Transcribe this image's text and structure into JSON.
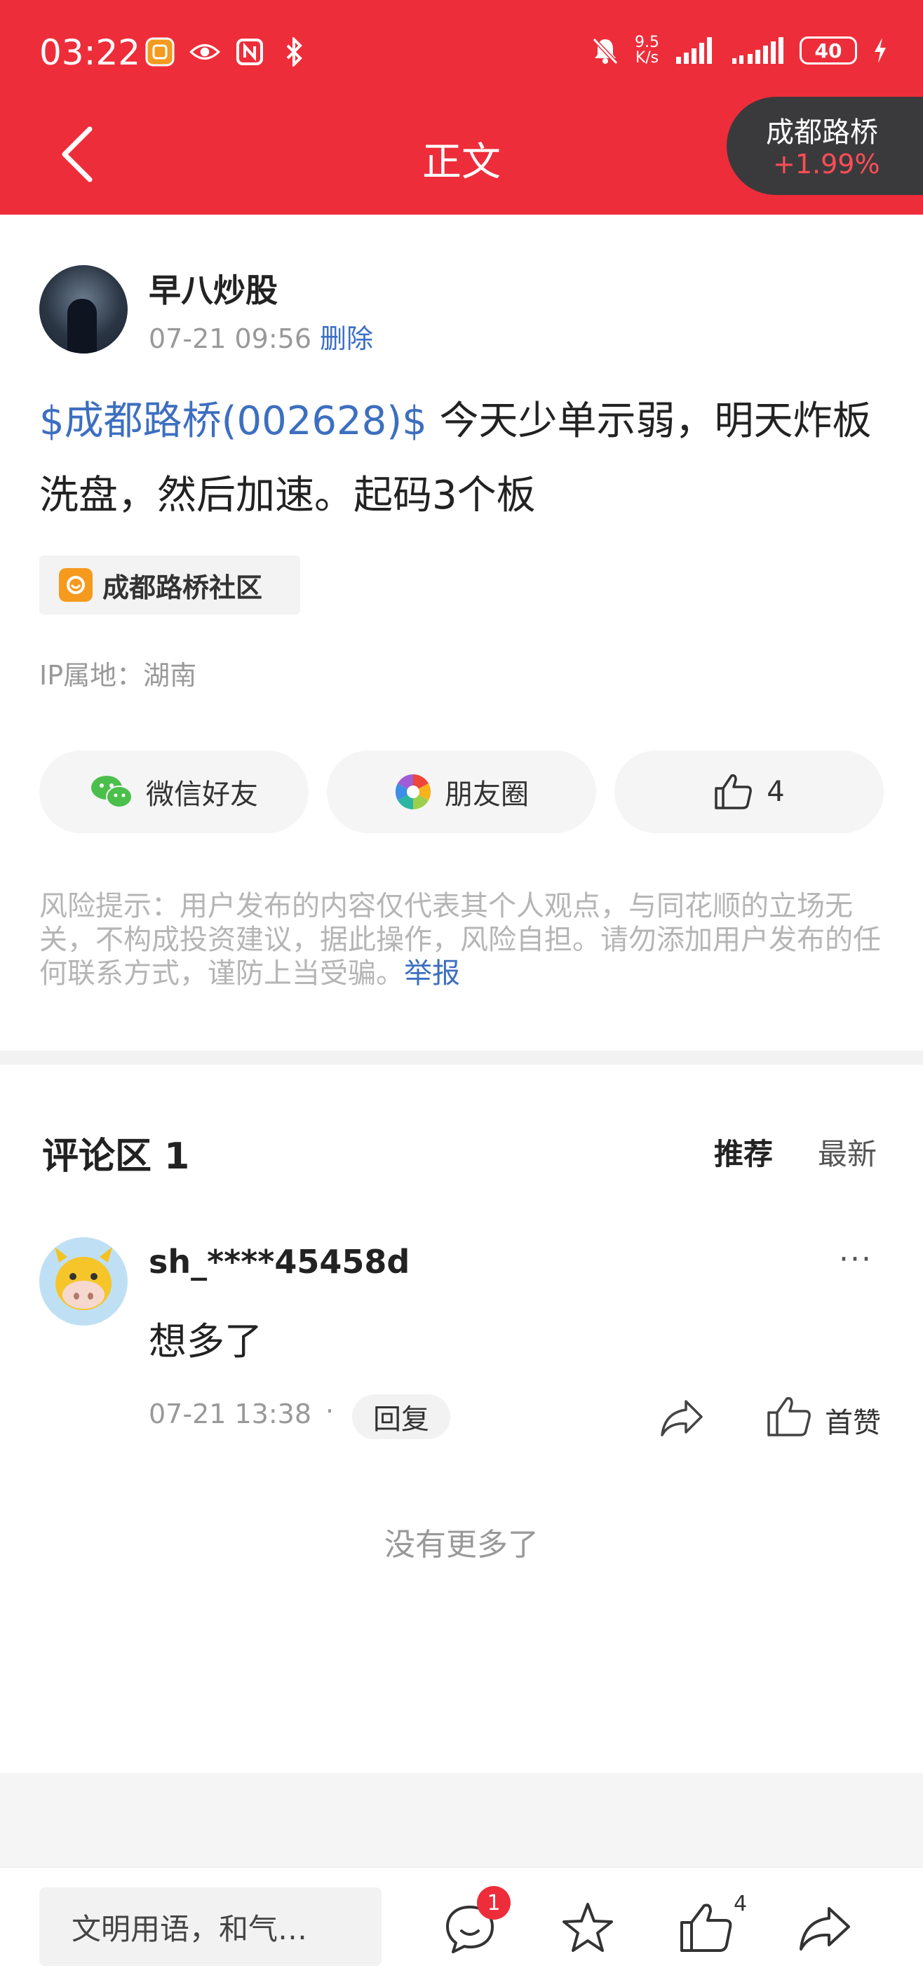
{
  "status_bar": {
    "time": "03:22",
    "net_speed_value": "9.5",
    "net_speed_unit": "K/s",
    "battery": "40"
  },
  "header": {
    "title": "正文",
    "stock_name": "成都路桥",
    "stock_change": "+1.99%"
  },
  "post": {
    "author": "早八炒股",
    "time": "07-21 09:56",
    "delete_label": "删除",
    "stock_tag": "$成都路桥(002628)$",
    "text": " 今天少单示弱，明天炸板洗盘，然后加速。起码3个板",
    "community": "成都路桥社区",
    "ip_location": "IP属地：湖南"
  },
  "share": {
    "wechat": "微信好友",
    "moments": "朋友圈",
    "likes": "4"
  },
  "risk": {
    "text": "风险提示：用户发布的内容仅代表其个人观点，与同花顺的立场无关，不构成投资建议，据此操作，风险自担。请勿添加用户发布的任何联系方式，谨防上当受骗。",
    "report": "举报"
  },
  "comments": {
    "title": "评论区 1",
    "sort_recommend": "推荐",
    "sort_latest": "最新",
    "items": [
      {
        "user": "sh_****45458d",
        "text": "想多了",
        "time": "07-21 13:38",
        "separator": "·",
        "reply": "回复",
        "like_label": "首赞",
        "more": "···"
      }
    ],
    "no_more": "没有更多了"
  },
  "bottom_bar": {
    "input_placeholder": "文明用语，和气…",
    "comment_badge": "1",
    "like_count": "4"
  }
}
